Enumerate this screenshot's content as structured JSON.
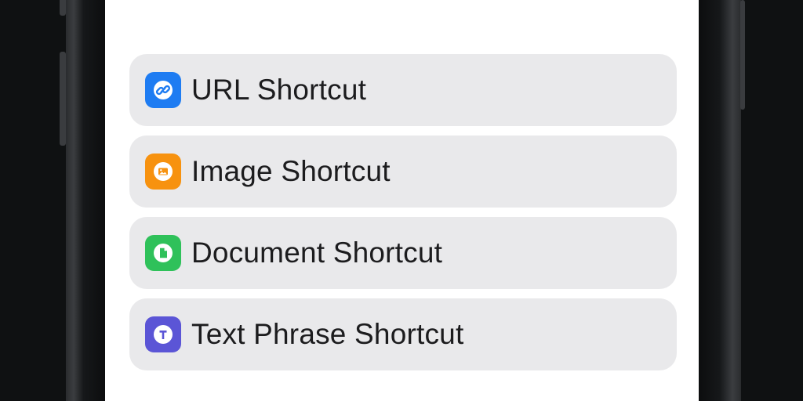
{
  "shortcuts": [
    {
      "label": "URL Shortcut",
      "icon": "link-icon",
      "color": "#1e7cf2"
    },
    {
      "label": "Image Shortcut",
      "icon": "image-icon",
      "color": "#f7920f"
    },
    {
      "label": "Document Shortcut",
      "icon": "document-icon",
      "color": "#2fc15a"
    },
    {
      "label": "Text Phrase Shortcut",
      "icon": "text-icon",
      "color": "#5b55d6"
    }
  ]
}
